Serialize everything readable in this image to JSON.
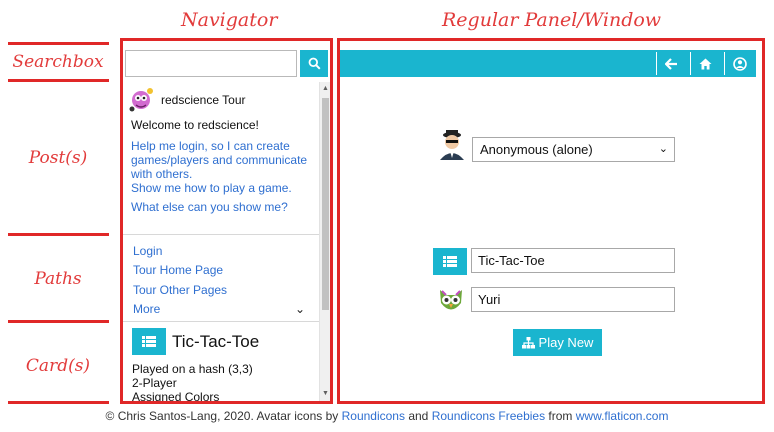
{
  "annotations": {
    "navigator": "Navigator",
    "panel": "Regular Panel/Window",
    "searchbox": "Searchbox",
    "posts": "Post(s)",
    "paths": "Paths",
    "cards": "Card(s)"
  },
  "navigator": {
    "search": {
      "value": "",
      "placeholder": "",
      "icon": "search-icon"
    },
    "post": {
      "title": "redscience Tour",
      "welcome": "Welcome to redscience!",
      "links": [
        "Help me login, so I can create games/players and communicate with others.",
        "Show me how to play a game.",
        "What else can you show me?"
      ]
    },
    "paths": [
      "Login",
      "Tour Home Page",
      "Tour Other Pages",
      "More"
    ],
    "card": {
      "title": "Tic-Tac-Toe",
      "icon": "list-icon",
      "lines": [
        "Played on a hash (3,3)",
        "2-Player",
        "Assigned Colors"
      ]
    }
  },
  "panel": {
    "toolbar": {
      "icons": [
        "back-arrow-icon",
        "home-icon",
        "user-circle-icon"
      ]
    },
    "player_select": {
      "value": "Anonymous (alone)"
    },
    "game_field": {
      "value": "Tic-Tac-Toe"
    },
    "player_field": {
      "value": "Yuri"
    },
    "play_button": "Play New"
  },
  "footer": {
    "prefix": "© Chris Santos-Lang, 2020. Avatar icons by ",
    "link1": "Roundicons",
    "and": " and ",
    "link2": "Roundicons Freebies",
    "from": " from ",
    "link3": "www.flaticon.com"
  },
  "colors": {
    "accent": "#1ab5cf",
    "annotation": "#e02828",
    "link": "#2f6fd0"
  }
}
